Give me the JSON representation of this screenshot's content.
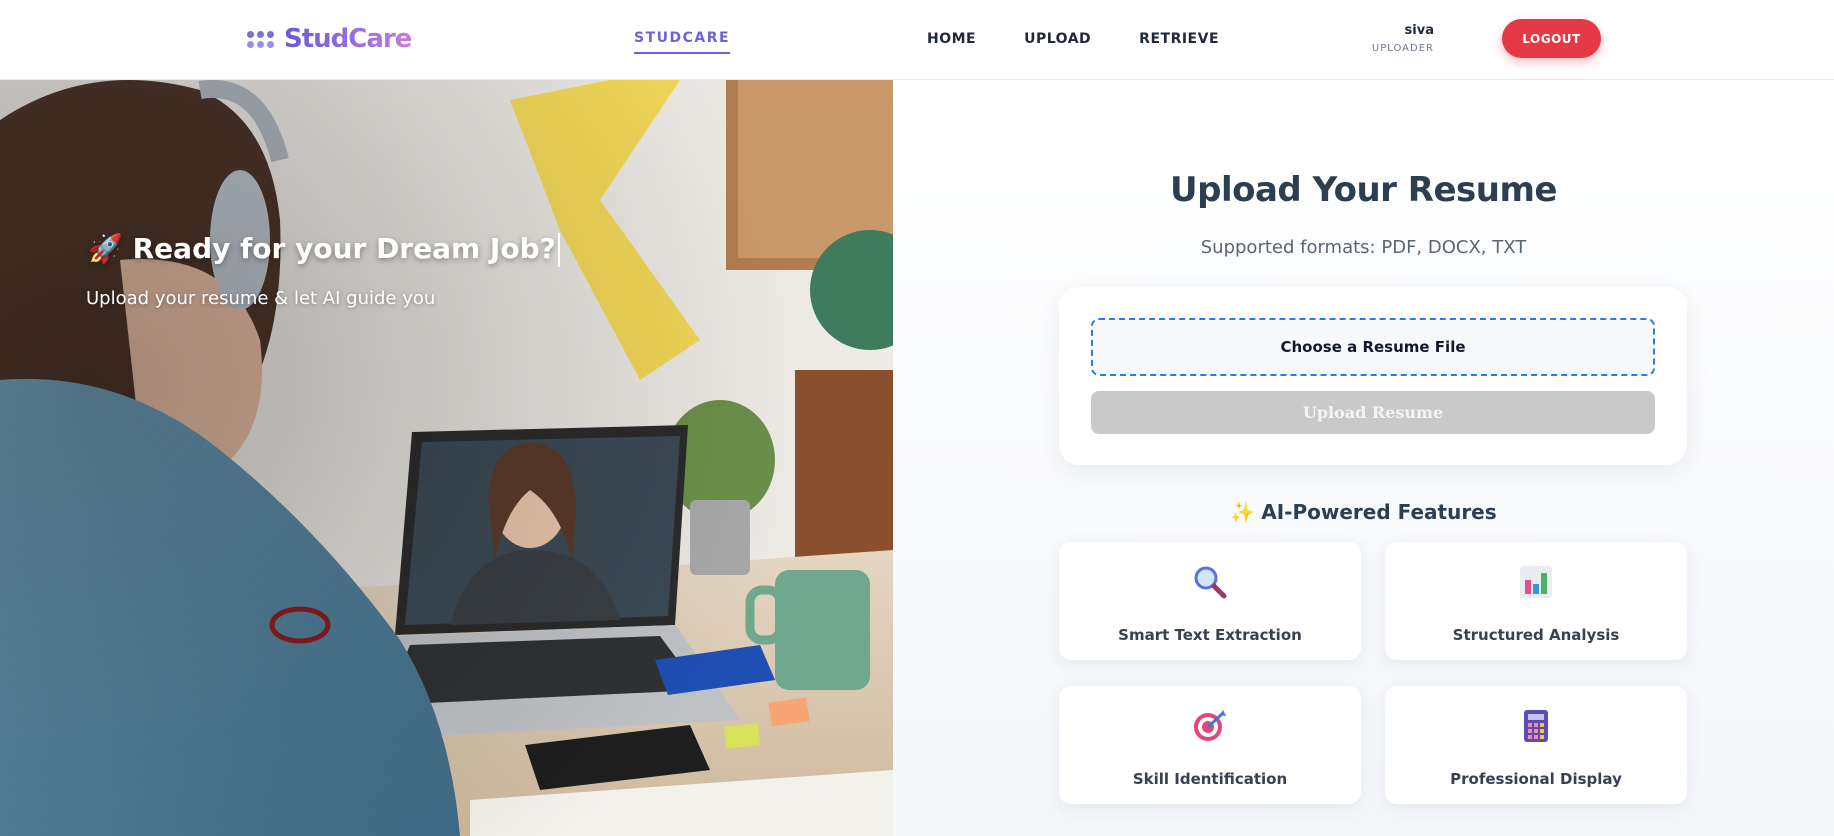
{
  "header": {
    "logo_text": "StudCare",
    "brand_link": "STUDCARE",
    "nav": [
      "HOME",
      "UPLOAD",
      "RETRIEVE"
    ],
    "user_name": "siva",
    "user_role": "UPLOADER",
    "logout_label": "LOGOUT",
    "logout_color": "#e53946",
    "accent_color": "#6c63d9"
  },
  "hero": {
    "title_icon": "rocket-icon",
    "title": "Ready for your Dream Job?",
    "subtitle": "Upload your resume & let AI guide you"
  },
  "upload": {
    "title": "Upload Your Resume",
    "formats": "Supported formats: PDF, DOCX, TXT",
    "choose_label": "Choose a Resume File",
    "upload_label": "Upload Resume"
  },
  "features": {
    "title": "AI-Powered Features",
    "title_icon": "sparkles-icon",
    "items": [
      {
        "icon": "magnifier-icon",
        "label": "Smart Text Extraction"
      },
      {
        "icon": "bar-chart-icon",
        "label": "Structured Analysis"
      },
      {
        "icon": "target-icon",
        "label": "Skill Identification"
      },
      {
        "icon": "calculator-icon",
        "label": "Professional Display"
      }
    ]
  }
}
